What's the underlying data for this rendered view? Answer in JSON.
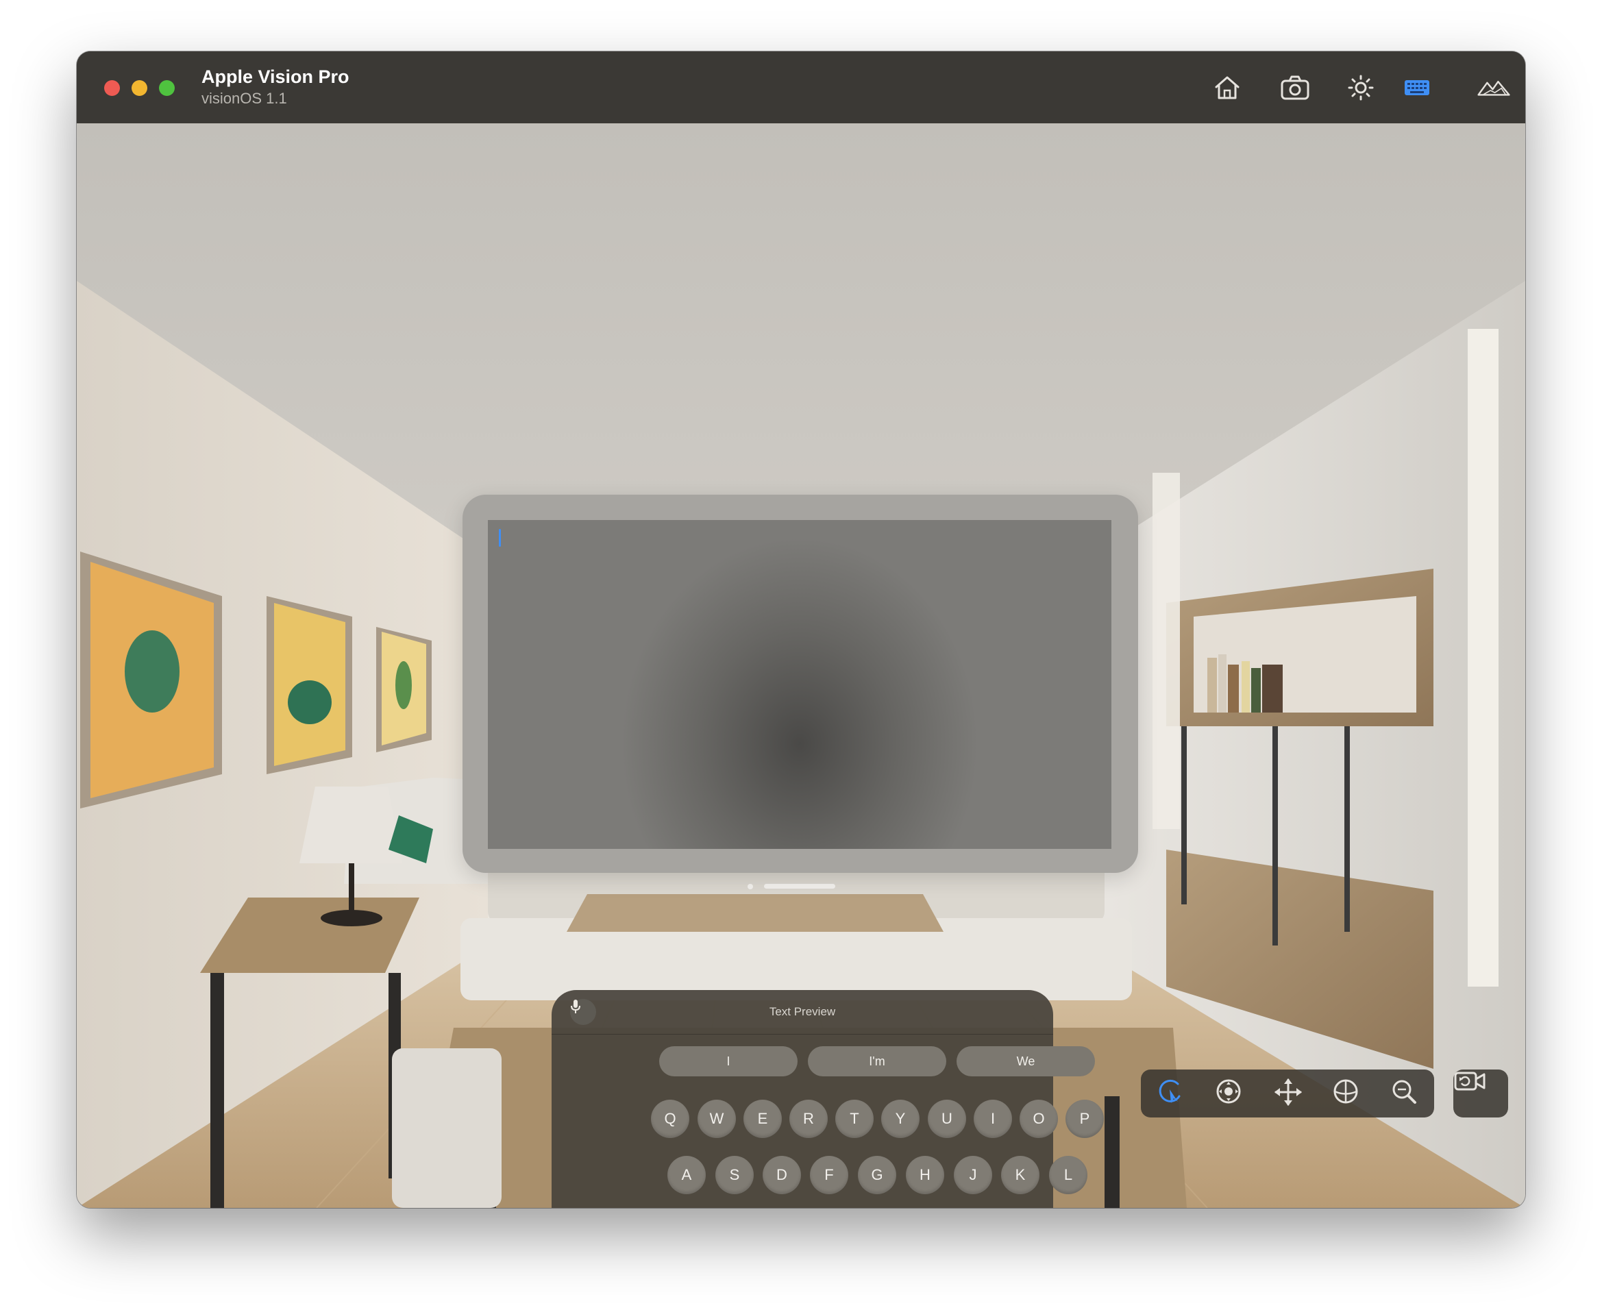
{
  "window": {
    "title": "Apple Vision Pro",
    "subtitle": "visionOS 1.1",
    "toolbar_icons": [
      "home-icon",
      "screenshot-camera-icon",
      "brightness-icon",
      "keyboard-icon",
      "environment-mountains-icon"
    ]
  },
  "keyboard": {
    "mic_icon": "microphone-icon",
    "preview_label": "Text Preview",
    "suggestions": [
      "I",
      "I'm",
      "We"
    ],
    "rows": [
      [
        "Q",
        "W",
        "E",
        "R",
        "T",
        "Y",
        "U",
        "I",
        "O",
        "P"
      ],
      [
        "A",
        "S",
        "D",
        "F",
        "G",
        "H",
        "J",
        "K",
        "L"
      ]
    ]
  },
  "interaction_tools": [
    "select-pointer-icon",
    "look-around-icon",
    "pan-icon",
    "orbit-icon",
    "zoom-icon",
    "camera-reset-icon"
  ],
  "colors": {
    "accent": "#3f8ff5",
    "titlebar": "#3b3935",
    "close": "#ee5b53",
    "minimize": "#f2b630",
    "zoom": "#4fc23f"
  }
}
